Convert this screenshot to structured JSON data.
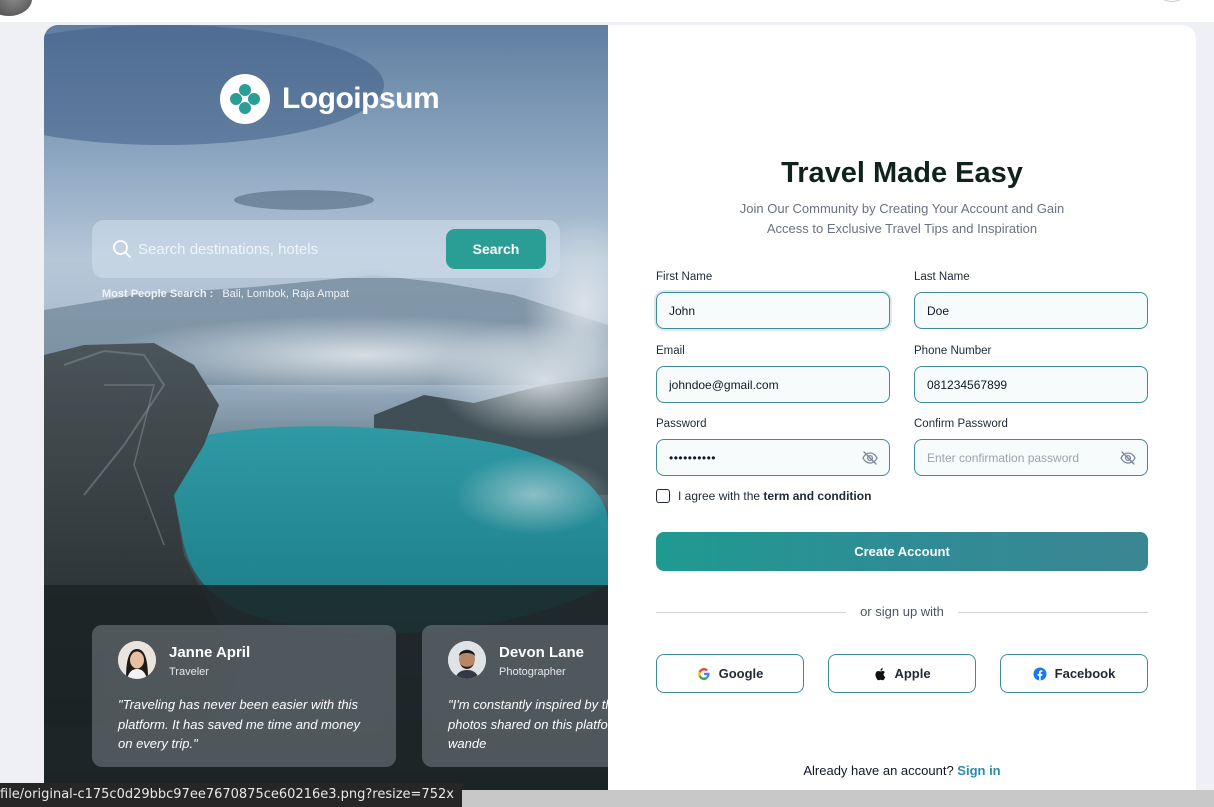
{
  "brand": {
    "name": "Logoipsum"
  },
  "search": {
    "placeholder": "Search destinations, hotels",
    "button_label": "Search",
    "popular_label": "Most People Search :",
    "popular_values": "Bali, Lombok, Raja Ampat"
  },
  "testimonials": [
    {
      "name": "Janne April",
      "role": "Traveler",
      "quote": "\"Traveling has never been easier with this platform. It has saved me time and money on every trip.\""
    },
    {
      "name": "Devon Lane",
      "role": "Photographer",
      "quote": "\"I'm constantly inspired by the stories and photos shared on this platform. It fuels my wande"
    }
  ],
  "form": {
    "title": "Travel Made Easy",
    "subtitle_line1": "Join Our Community by Creating Your Account and Gain",
    "subtitle_line2": "Access to Exclusive Travel Tips and Inspiration",
    "first_name": {
      "label": "First Name",
      "value": "John"
    },
    "last_name": {
      "label": "Last Name",
      "value": "Doe"
    },
    "email": {
      "label": "Email",
      "value": "johndoe@gmail.com"
    },
    "phone": {
      "label": "Phone Number",
      "value": "081234567899"
    },
    "password": {
      "label": "Password",
      "value": "••••••••••"
    },
    "confirm_password": {
      "label": "Confirm Password",
      "placeholder": "Enter confirmation password"
    },
    "agree_prefix": "I agree with the",
    "agree_link": "term and condition",
    "create_label": "Create Account",
    "divider": "or sign up with",
    "social": {
      "google": "Google",
      "apple": "Apple",
      "facebook": "Facebook"
    },
    "signin_prompt": "Already have an account?",
    "signin_link": "Sign in"
  },
  "status_url": "file/original-c175c0d29bbc97ee7670875ce60216e3.png?resize=752x",
  "colors": {
    "accent": "#2a9d95",
    "field_border": "#3b8c96",
    "link": "#2a8fa3",
    "title": "#10221b"
  },
  "icons": [
    "logo-icon",
    "search-icon",
    "eye-off-icon",
    "google-icon",
    "apple-icon",
    "facebook-icon"
  ]
}
